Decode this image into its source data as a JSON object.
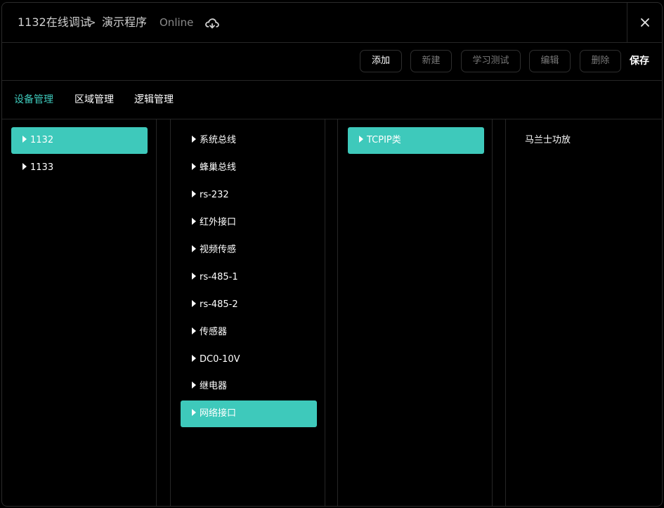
{
  "titlebar": {
    "device": "1132在线调试",
    "separator": ">",
    "program": "演示程序",
    "status": "Online",
    "status_icon": "cloud-sync-icon",
    "close_icon": "close-icon"
  },
  "toolbar": {
    "add": "添加",
    "new": "新建",
    "learn_test": "学习测试",
    "edit": "编辑",
    "delete": "删除",
    "save": "保存"
  },
  "tabs": [
    {
      "label": "设备管理",
      "active": true
    },
    {
      "label": "区域管理",
      "active": false
    },
    {
      "label": "逻辑管理",
      "active": false
    }
  ],
  "columns": {
    "devices": [
      {
        "label": "1132",
        "selected": true
      },
      {
        "label": "1133",
        "selected": false
      }
    ],
    "interfaces": [
      {
        "label": "系统总线",
        "selected": false
      },
      {
        "label": "蜂巢总线",
        "selected": false
      },
      {
        "label": "rs-232",
        "selected": false
      },
      {
        "label": "红外接口",
        "selected": false
      },
      {
        "label": "视频传感",
        "selected": false
      },
      {
        "label": "rs-485-1",
        "selected": false
      },
      {
        "label": "rs-485-2",
        "selected": false
      },
      {
        "label": "传感器",
        "selected": false
      },
      {
        "label": "DC0-10V",
        "selected": false
      },
      {
        "label": "继电器",
        "selected": false
      },
      {
        "label": "网络接口",
        "selected": true
      }
    ],
    "categories": [
      {
        "label": "TCPIP类",
        "selected": true
      }
    ],
    "items": [
      {
        "label": "马兰士功放"
      }
    ]
  },
  "colors": {
    "accent": "#3ec9bb",
    "background": "#000000",
    "border": "#262626",
    "disabled_text": "#7a7a7a"
  }
}
